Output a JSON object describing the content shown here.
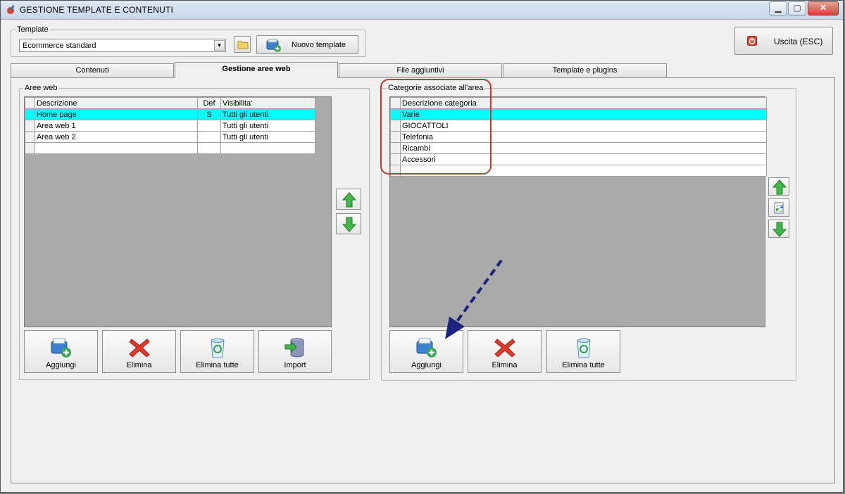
{
  "window": {
    "title": "GESTIONE TEMPLATE E CONTENUTI",
    "controls": {
      "minimize": "▁",
      "maximize": "▢",
      "close": "✕"
    }
  },
  "template": {
    "group_label": "Template",
    "selected": "Ecommerce standard",
    "new_button": "Nuovo template"
  },
  "exit_button": "Uscita (ESC)",
  "tabs": [
    {
      "label": "Contenuti"
    },
    {
      "label": "Gestione aree web",
      "active": true
    },
    {
      "label": "File aggiuntivi"
    },
    {
      "label": "Template e plugins"
    }
  ],
  "areas": {
    "group_label": "Aree web",
    "columns": [
      "Descrizione",
      "Def",
      "Visibilita'"
    ],
    "rows": [
      {
        "descrizione": "Home page",
        "def": "S",
        "visibilita": "Tutti gli utenti",
        "selected": true
      },
      {
        "descrizione": "Area web 1",
        "def": "",
        "visibilita": "Tutti gli utenti"
      },
      {
        "descrizione": "Area web 2",
        "def": "",
        "visibilita": "Tutti gli utenti"
      }
    ],
    "buttons": {
      "add": "Aggiungi",
      "delete": "Elimina",
      "delete_all": "Elimina tutte",
      "import": "Import"
    }
  },
  "categories": {
    "group_label": "Categorie associate all'area",
    "columns": [
      "Descrizione categoria"
    ],
    "rows": [
      {
        "descrizione": "Varie",
        "selected": true
      },
      {
        "descrizione": "GIOCATTOLI"
      },
      {
        "descrizione": "Telefonia"
      },
      {
        "descrizione": "Ricambi"
      },
      {
        "descrizione": "Accessori"
      }
    ],
    "buttons": {
      "add": "Aggiungi",
      "delete": "Elimina",
      "delete_all": "Elimina tutte"
    }
  },
  "colors": {
    "selection": "#00ffff",
    "annotation": "#c0392b",
    "arrow": "#1a237e",
    "grid_bg": "#aaaaaa"
  }
}
